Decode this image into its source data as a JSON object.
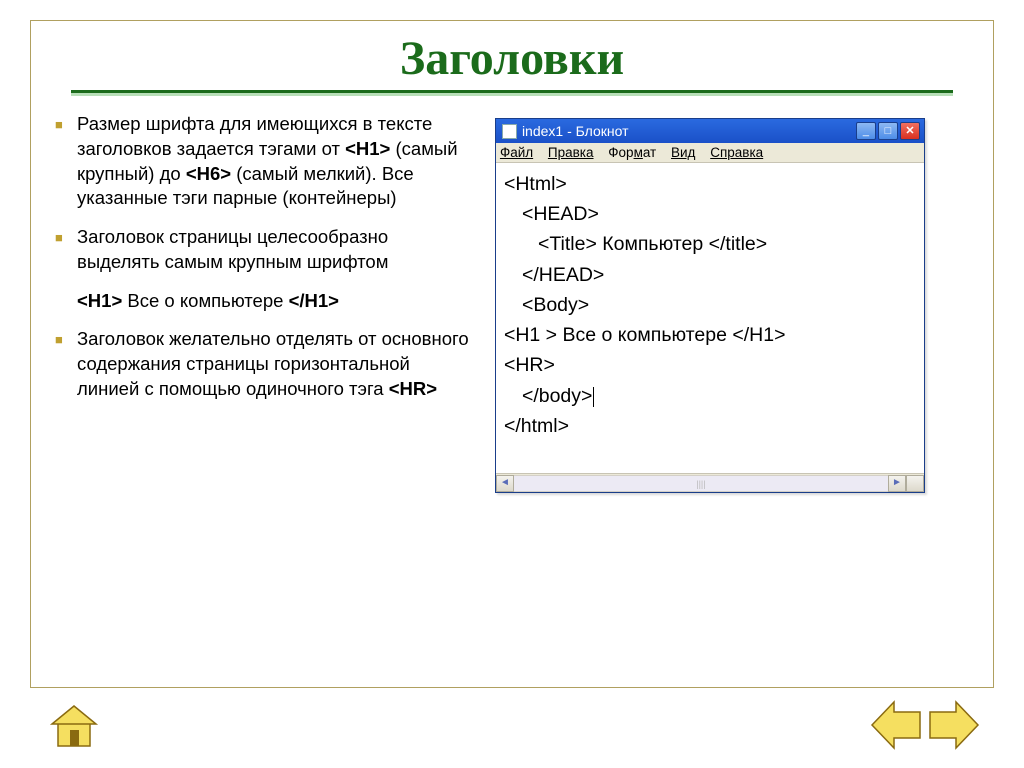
{
  "slide": {
    "title": "Заголовки",
    "bullets": [
      {
        "type": "bulleted",
        "html": "Размер шрифта для имеющихся в тексте заголовков задается тэгами от <b>&lt;H1&gt;</b> (самый крупный) до <b>&lt;H6&gt;</b> (самый мелкий). Все указанные тэги парные (контейнеры)"
      },
      {
        "type": "bulleted",
        "html": "Заголовок страницы целесообразно выделять самым крупным шрифтом"
      },
      {
        "type": "nobullet",
        "html": "<b>&lt;H1&gt;</b> Все о компьютере <b>&lt;/H1&gt;</b>"
      },
      {
        "type": "bulleted",
        "html": "Заголовок желательно отделять от основного содержания страницы горизонтальной линией с помощью одиночного тэга <b>&lt;HR&gt;</b>"
      }
    ]
  },
  "notepad": {
    "title": "index1 - Блокнот",
    "menu": {
      "file": "Файл",
      "edit": "Правка",
      "format": "Формат",
      "view": "Вид",
      "help": "Справка"
    },
    "winbtns": {
      "min": "_",
      "max": "□",
      "close": "✕"
    },
    "code": {
      "l1": "<Html>",
      "l2": "<HEAD>",
      "l3": "<Title> Компьютер </title>",
      "l4": "</HEAD>",
      "l5": "<Body>",
      "l6": "<H1 > Все о компьютере </H1>",
      "l7": "<HR>",
      "l8": "</body>",
      "l9": "</html>"
    },
    "scrolltrack": "||||"
  },
  "nav": {
    "home": "home-icon",
    "prev": "prev-arrow",
    "next": "next-arrow"
  }
}
